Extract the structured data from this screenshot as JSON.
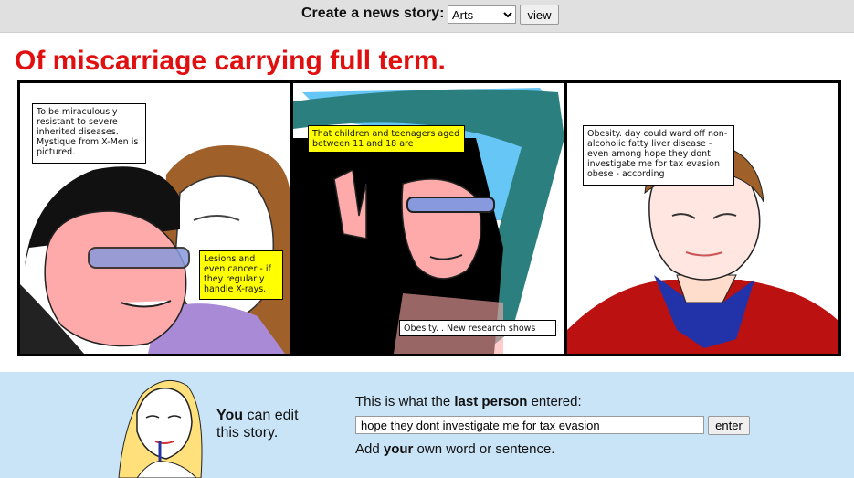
{
  "topbar": {
    "create_label": "Create a news story:",
    "category_selected": "Arts",
    "view_label": "view"
  },
  "headline": "Of miscarriage carrying full term.",
  "panels": [
    {
      "bubbles": [
        {
          "text": "To be miraculously resistant to severe inherited diseases. Mystique from X-Men is pictured.",
          "style": "white"
        },
        {
          "text": "Lesions and even cancer - if they regularly handle X-rays.",
          "style": "yellow"
        }
      ]
    },
    {
      "bubbles": [
        {
          "text": "That children and teenagers aged between 11 and 18 are",
          "style": "yellow"
        },
        {
          "text": "Obesity. . New research shows",
          "style": "white"
        }
      ]
    },
    {
      "bubbles": [
        {
          "text": "Obesity. day could ward off non-alcoholic fatty liver disease - even among hope they dont investigate me for tax evasion obese - according",
          "style": "white"
        }
      ]
    }
  ],
  "editor": {
    "you": "You",
    "can_edit": " can edit",
    "this_story": "this story.",
    "last_prefix": "This is what the ",
    "last_bold": "last person",
    "last_suffix": " entered:",
    "input_value": "hope they dont investigate me for tax evasion",
    "enter_label": "enter",
    "add_prefix": "Add ",
    "add_bold": "your",
    "add_suffix": " own word or sentence."
  },
  "colors": {
    "headline": "#e01010",
    "bottom_bg": "#c9e4f7",
    "bubble_yellow": "#ffff00",
    "sky": "#66c6f5"
  }
}
